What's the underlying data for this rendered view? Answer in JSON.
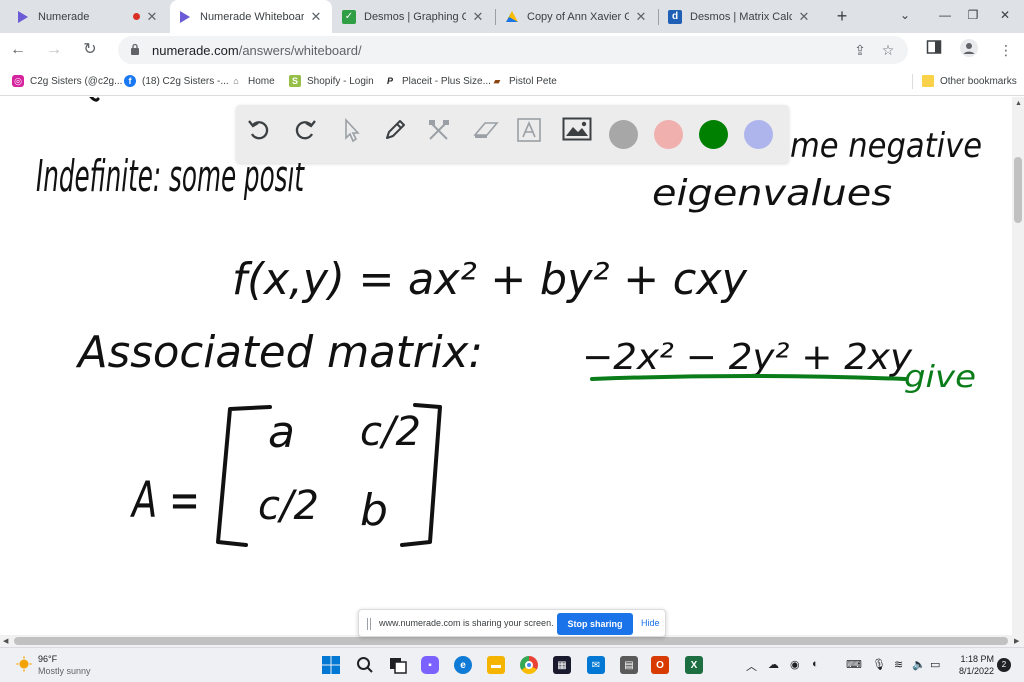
{
  "browser": {
    "tabs": [
      {
        "title": "Numerade",
        "active": false,
        "recording": true
      },
      {
        "title": "Numerade Whiteboard",
        "active": true
      },
      {
        "title": "Desmos | Graphing Calcula",
        "active": false
      },
      {
        "title": "Copy of Ann Xavier Gante",
        "active": false
      },
      {
        "title": "Desmos | Matrix Calculator",
        "active": false
      }
    ],
    "url_host": "numerade.com",
    "url_path": "/answers/whiteboard/",
    "bookmarks": [
      {
        "label": "C2g Sisters (@c2g...",
        "icon": "instagram-icon"
      },
      {
        "label": "(18) C2g Sisters -...",
        "icon": "facebook-icon"
      },
      {
        "label": "Home",
        "icon": "home-icon"
      },
      {
        "label": "Shopify - Login",
        "icon": "shopify-icon"
      },
      {
        "label": "Placeit - Plus Size...",
        "icon": "placeit-icon"
      },
      {
        "label": "Pistol Pete",
        "icon": "pistol-icon"
      }
    ],
    "other_bookmarks": "Other bookmarks"
  },
  "whiteboard": {
    "tools": [
      "undo-icon",
      "redo-icon",
      "select-icon",
      "pen-icon",
      "shapes-icon",
      "eraser-icon",
      "text-icon",
      "image-icon"
    ],
    "colors": [
      {
        "name": "gray",
        "hex": "#a7a7a7"
      },
      {
        "name": "pink",
        "hex": "#f0b0ae"
      },
      {
        "name": "green",
        "hex": "#008000"
      },
      {
        "name": "lavender",
        "hex": "#aeb4ec"
      }
    ],
    "handwriting": {
      "line1": "Indefinite: some positive and some negative",
      "line1_visible_left": "Indefinite: some posit",
      "line1_visible_right": "me negative",
      "line2": "eigenvalues",
      "equation": "f(x,y) = ax² + by² + cxy",
      "assoc_label": "Associated matrix:",
      "example_poly": "−2x² − 2y² + 2xy",
      "green_note": "give",
      "matrix_name": "A =",
      "matrix": [
        [
          "a",
          "c/2"
        ],
        [
          "c/2",
          "b"
        ]
      ]
    }
  },
  "share_banner": {
    "message": "www.numerade.com is sharing your screen.",
    "stop_label": "Stop sharing",
    "hide_label": "Hide"
  },
  "taskbar": {
    "temperature": "96°F",
    "condition": "Mostly sunny",
    "time": "1:18 PM",
    "date": "8/1/2022",
    "notification_count": "2"
  }
}
